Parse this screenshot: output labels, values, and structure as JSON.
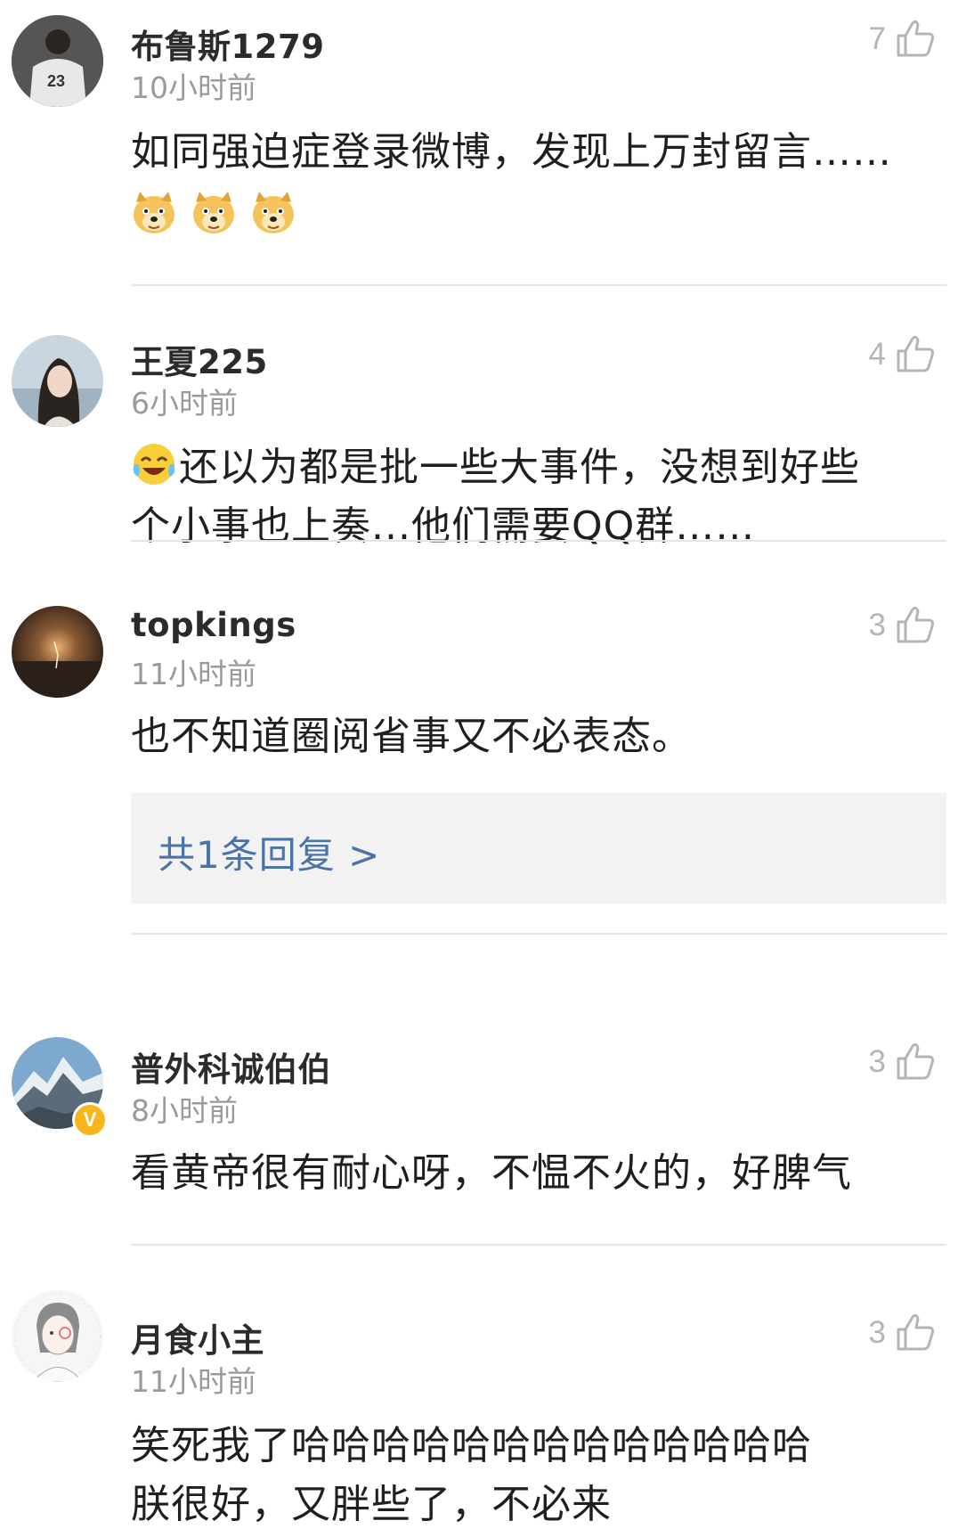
{
  "comments": [
    {
      "username": "布鲁斯1279",
      "time": "10小时前",
      "likes": "7",
      "text_line1": "如同强迫症登录微博，发现上万封留言……",
      "emoji_icons": [
        "doge-emoji",
        "doge-emoji",
        "doge-emoji"
      ]
    },
    {
      "username": "王夏225",
      "time": "6小时前",
      "likes": "4",
      "leading_emoji": "crying-laugh-emoji",
      "text_line1": "还以为都是批一些大事件，没想到好些",
      "text_line2": "个小事也上奏...他们需要QQ群……"
    },
    {
      "username": "topkings",
      "time": "11小时前",
      "likes": "3",
      "text_line1": "也不知道圈阅省事又不必表态。",
      "reply_link": "共1条回复 >"
    },
    {
      "username": "普外科诚伯伯",
      "time": "8小时前",
      "likes": "3",
      "verified_badge": "V",
      "text_line1": "看黄帝很有耐心呀，不愠不火的，好脾气"
    },
    {
      "username": "月食小主",
      "time": "11小时前",
      "likes": "3",
      "text_line1": "笑死我了哈哈哈哈哈哈哈哈哈哈哈哈哈",
      "text_line2": "朕很好，又胖些了，不必来"
    }
  ],
  "colors": {
    "link": "#4a74a6",
    "muted": "#9a9a9a",
    "divider": "#e4e4e4",
    "reply_bg": "#f2f2f2",
    "verified": "#f5b71b"
  }
}
